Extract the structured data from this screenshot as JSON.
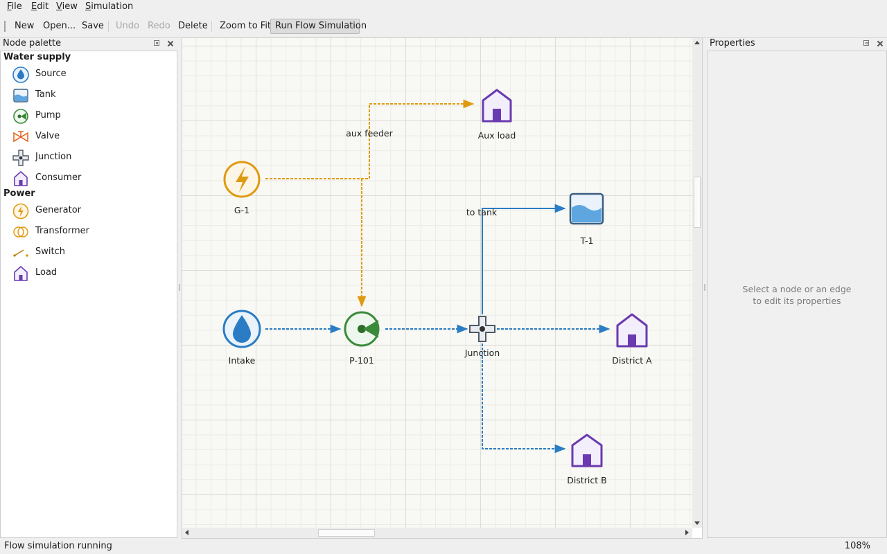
{
  "menu": {
    "items": [
      "File",
      "Edit",
      "View",
      "Simulation"
    ]
  },
  "toolbar": {
    "new": "New",
    "open": "Open...",
    "save": "Save",
    "undo": "Undo",
    "redo": "Redo",
    "delete": "Delete",
    "zoom_fit": "Zoom to Fit",
    "run_sim": "Run Flow Simulation"
  },
  "palette": {
    "title": "Node palette",
    "categories": [
      {
        "name": "Water supply",
        "items": [
          {
            "label": "Source",
            "icon": "water-drop-icon"
          },
          {
            "label": "Tank",
            "icon": "tank-icon"
          },
          {
            "label": "Pump",
            "icon": "pump-icon"
          },
          {
            "label": "Valve",
            "icon": "valve-icon"
          },
          {
            "label": "Junction",
            "icon": "junction-icon"
          },
          {
            "label": "Consumer",
            "icon": "house-icon"
          }
        ]
      },
      {
        "name": "Power",
        "items": [
          {
            "label": "Generator",
            "icon": "lightning-icon"
          },
          {
            "label": "Transformer",
            "icon": "transformer-icon"
          },
          {
            "label": "Switch",
            "icon": "switch-icon"
          },
          {
            "label": "Load",
            "icon": "house-icon"
          }
        ]
      }
    ]
  },
  "canvas": {
    "nodes": {
      "g1": "G-1",
      "aux_load": "Aux load",
      "t1": "T-1",
      "intake": "Intake",
      "p101": "P-101",
      "junction": "Junction",
      "district_a": "District A",
      "district_b": "District B"
    },
    "edge_labels": {
      "aux_feeder": "aux feeder",
      "to_tank": "to tank"
    }
  },
  "properties": {
    "title": "Properties",
    "hint_line1": "Select a node or an edge",
    "hint_line2": "to edit its properties"
  },
  "status": {
    "message": "Flow simulation running",
    "zoom": "108%"
  },
  "colors": {
    "water": "#2a7cc4",
    "power": "#e09a10",
    "pump": "#3a8a3a",
    "consumer": "#6a3ab0",
    "valve": "#e06020"
  }
}
